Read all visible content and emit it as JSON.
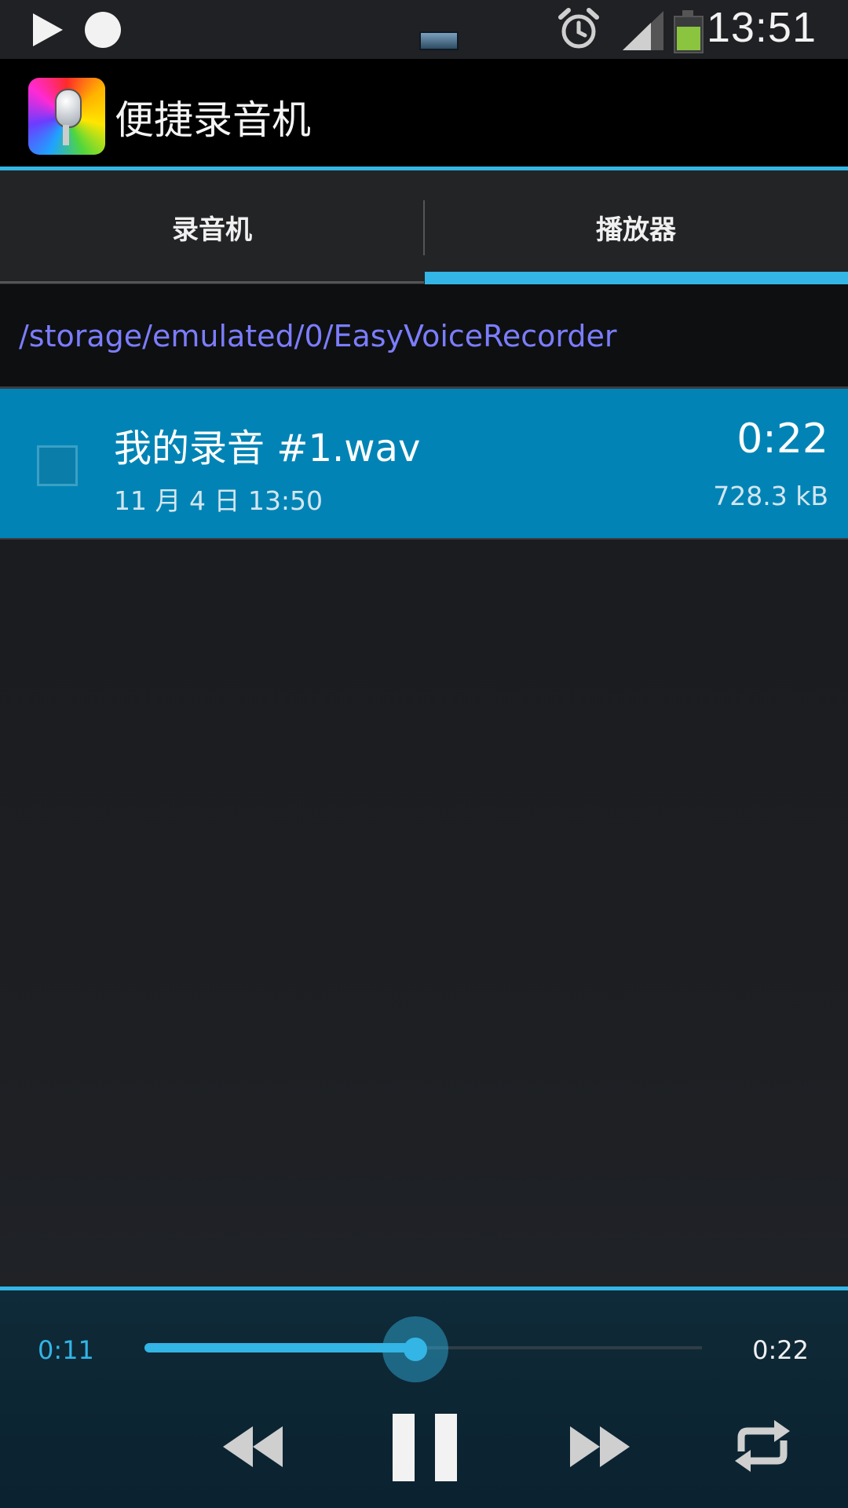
{
  "status_bar": {
    "time": "13:51",
    "icons": [
      "play-icon",
      "record-dot-icon",
      "usb-battery-icon",
      "alarm-icon",
      "signal-icon",
      "battery-icon"
    ]
  },
  "action_bar": {
    "app_title": "便捷录音机",
    "app_icon": "microphone-app-icon"
  },
  "tabs": [
    {
      "label": "录音机",
      "selected": false
    },
    {
      "label": "播放器",
      "selected": true
    }
  ],
  "path": "/storage/emulated/0/EasyVoiceRecorder",
  "files": [
    {
      "name": "我的录音 #1.wav",
      "date": "11 月 4 日 13:50",
      "duration": "0:22",
      "size": "728.3 kB",
      "checked": false,
      "selected": true
    }
  ],
  "player": {
    "elapsed": "0:11",
    "total": "0:22",
    "progress_fraction": 0.5,
    "controls": [
      "rewind-icon",
      "pause-icon",
      "fast-forward-icon",
      "repeat-icon"
    ]
  },
  "colors": {
    "accent": "#33b5e5",
    "path_text": "#7b7dff",
    "selected_row": "#0184b5"
  }
}
